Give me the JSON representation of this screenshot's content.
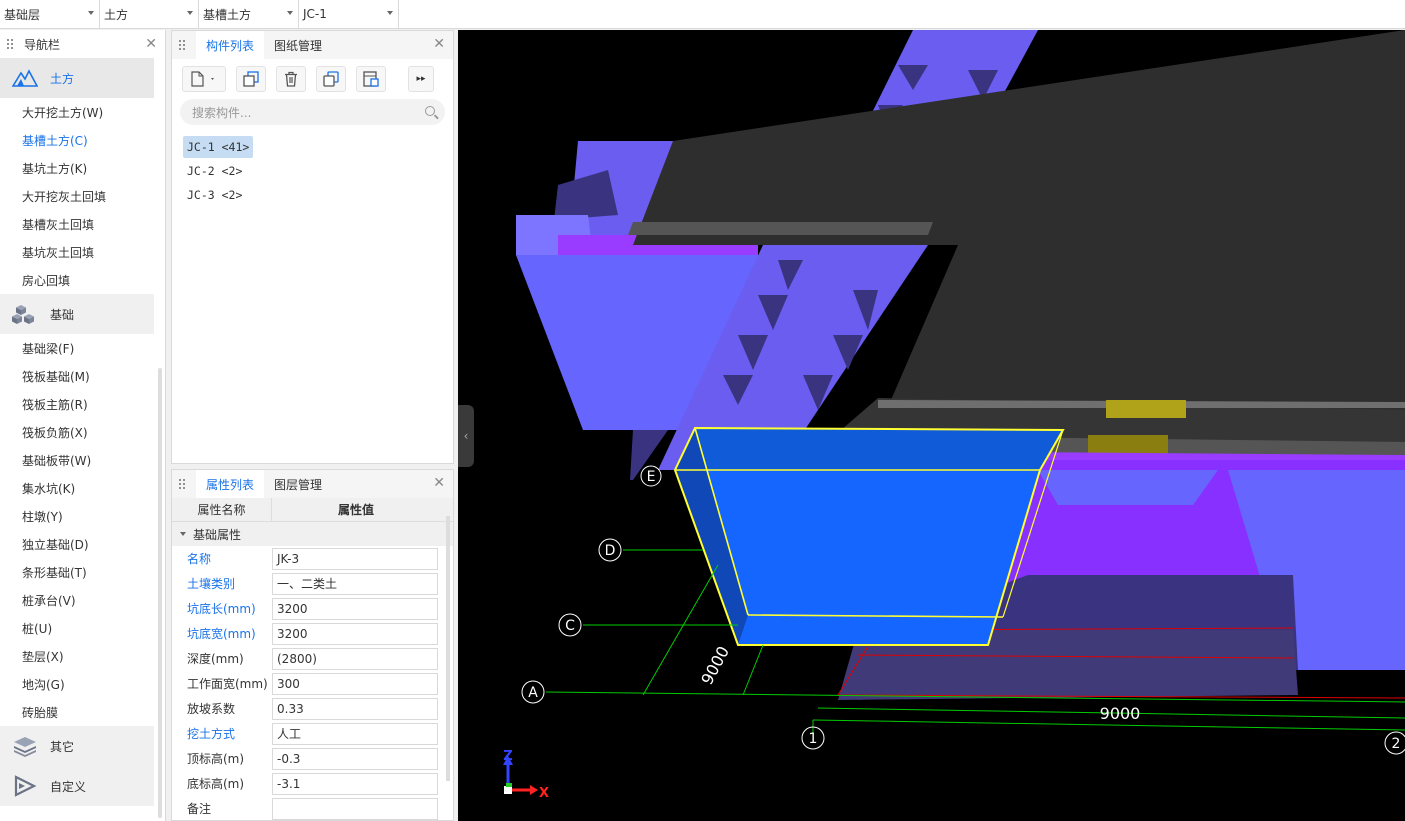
{
  "top_selectors": [
    "基础层",
    "土方",
    "基槽土方",
    "JC-1"
  ],
  "nav": {
    "title": "导航栏",
    "categories": [
      {
        "label": "土方",
        "items": [
          "大开挖土方(W)",
          "基槽土方(C)",
          "基坑土方(K)",
          "大开挖灰土回填",
          "基槽灰土回填",
          "基坑灰土回填",
          "房心回填"
        ]
      },
      {
        "label": "基础",
        "items": [
          "基础梁(F)",
          "筏板基础(M)",
          "筏板主筋(R)",
          "筏板负筋(X)",
          "基础板带(W)",
          "集水坑(K)",
          "柱墩(Y)",
          "独立基础(D)",
          "条形基础(T)",
          "桩承台(V)",
          "桩(U)",
          "垫层(X)",
          "地沟(G)",
          "砖胎膜"
        ]
      },
      {
        "label": "其它",
        "items": []
      },
      {
        "label": "自定义",
        "items": []
      }
    ],
    "active_item": "基槽土方(C)"
  },
  "complist": {
    "tabs": [
      "构件列表",
      "图纸管理"
    ],
    "search_placeholder": "搜索构件...",
    "items": [
      "JC-1 <41>",
      "JC-2 <2>",
      "JC-3 <2>"
    ],
    "selected": "JC-1 <41>"
  },
  "props": {
    "tabs": [
      "属性列表",
      "图层管理"
    ],
    "col_name": "属性名称",
    "col_value": "属性值",
    "group": "基础属性",
    "rows": [
      {
        "name": "名称",
        "value": "JK-3",
        "blue": true
      },
      {
        "name": "土壤类别",
        "value": "一、二类土",
        "blue": true
      },
      {
        "name": "坑底长(mm)",
        "value": "3200",
        "blue": true
      },
      {
        "name": "坑底宽(mm)",
        "value": "3200",
        "blue": true
      },
      {
        "name": "深度(mm)",
        "value": "(2800)",
        "blue": false
      },
      {
        "name": "工作面宽(mm)",
        "value": "300",
        "blue": false
      },
      {
        "name": "放坡系数",
        "value": "0.33",
        "blue": false
      },
      {
        "name": "挖土方式",
        "value": "人工",
        "blue": true
      },
      {
        "name": "顶标高(m)",
        "value": "-0.3",
        "blue": false
      },
      {
        "name": "底标高(m)",
        "value": "-3.1",
        "blue": false
      },
      {
        "name": "备注",
        "value": "",
        "blue": false
      }
    ]
  },
  "viewport": {
    "axis_labels": [
      "E",
      "D",
      "C",
      "A",
      "1",
      "2"
    ],
    "dims": [
      "9000",
      "9000"
    ],
    "triad": {
      "z": "Z",
      "x": "X"
    }
  },
  "colors": {
    "accent": "#1a73e8",
    "earth": "#6666ff",
    "pit": "#1565ff",
    "slab": "#2e2e2e",
    "highlight": "#ffff00"
  }
}
